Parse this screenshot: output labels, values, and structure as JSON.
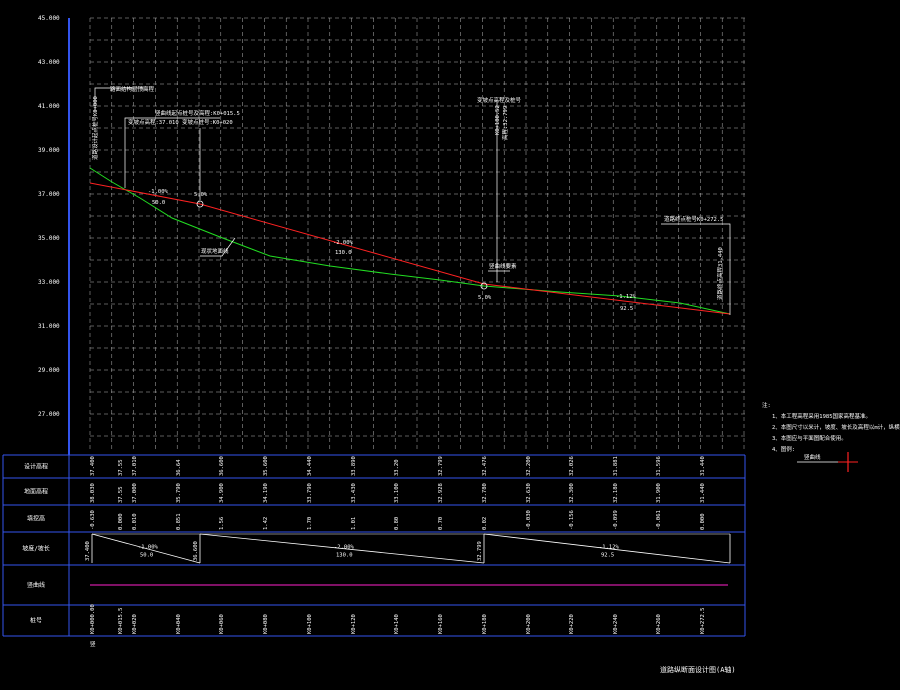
{
  "y_axis": {
    "ticks": [
      "45.000",
      "43.000",
      "41.000",
      "39.000",
      "37.000",
      "35.000",
      "33.000",
      "31.000",
      "29.000",
      "27.000"
    ]
  },
  "table": {
    "row_labels": [
      "设计高程",
      "地面高程",
      "填挖高",
      "坡度/坡长",
      "竖曲线",
      "桩号"
    ],
    "design": [
      "37.400",
      "37.55",
      "37.010",
      "36.64",
      "36.600",
      "35.600",
      "34.440",
      "33.890",
      "33.20",
      "32.799",
      "32.476",
      "32.200",
      "32.026",
      "31.881",
      "31.596",
      "31.440"
    ],
    "ground": [
      "38.030",
      "37.55",
      "37.000",
      "35.790",
      "34.900",
      "34.190",
      "33.790",
      "33.430",
      "33.100",
      "32.928",
      "32.780",
      "32.630",
      "32.300",
      "32.180",
      "31.900",
      "31.440"
    ],
    "fill": [
      "-0.630",
      "0.000",
      "0.010",
      "0.851",
      "1.56",
      "1.42",
      "1.70",
      "1.01",
      "0.80",
      "0.70",
      "0.02",
      "-0.030",
      "-0.156",
      "-0.099",
      "-0.061",
      "0.000"
    ],
    "stations": [
      "K0+000.00",
      "K0+015.5",
      "K0+020",
      "K0+040",
      "K0+060",
      "K0+080",
      "K0+100",
      "K0+120",
      "K0+140",
      "K0+160",
      "K0+180",
      "K0+200",
      "K0+220",
      "K0+240",
      "K0+260",
      "K0+272.5"
    ],
    "station_sub": "竖",
    "grades": [
      {
        "elev": "37.400",
        "g": "-1.00%",
        "len": "50.0"
      },
      {
        "elev": "36.600",
        "g": "-2.00%",
        "len": "130.0"
      },
      {
        "elev": "32.799",
        "g": "-1.12%",
        "len": "92.5"
      }
    ]
  },
  "annotations": {
    "start_top": "路面结构层顶高程",
    "start_side": "道路设计起点桩号K0+000",
    "point1_a": "竖曲线起点桩号及高程:K0+015.5",
    "point1_b": "变坡点高程:37.010 变坡点桩号:K0+020",
    "mid_top": "变坡点高程及桩号",
    "mid_v1": "K0+180.52",
    "mid_v2": "高程:32.799",
    "end_top": "道路终点桩号K0+272.5",
    "end_side": "道路终点高程31.440",
    "grade1": "-1.00%",
    "len1": "50.0",
    "grade2": "-2.00%",
    "len2": "130.0",
    "grade3": "-1.12%",
    "len3": "92.5",
    "pt1": "5.0%",
    "pt2": "5.0%",
    "ground_label": "现状地面线",
    "vcurve_label": "竖曲线要素"
  },
  "notes": {
    "heading": "注:",
    "items": [
      "1、本工程高程采用1985国家高程基准。",
      "2、本图尺寸以米计，坡度、坡长及高程以m计，纵横比例1:500。",
      "3、本图应与平面图配合使用。",
      "4、图例:"
    ],
    "legend_label": "竖曲线"
  },
  "title": "道路纵断面设计图(A轴)",
  "colors": {
    "grid": "#b8b8b8",
    "design": "#ff2222",
    "ground": "#22dd22",
    "frame": "#3355ee",
    "vcurve": "#ff22cc",
    "text": "#ffffff"
  }
}
